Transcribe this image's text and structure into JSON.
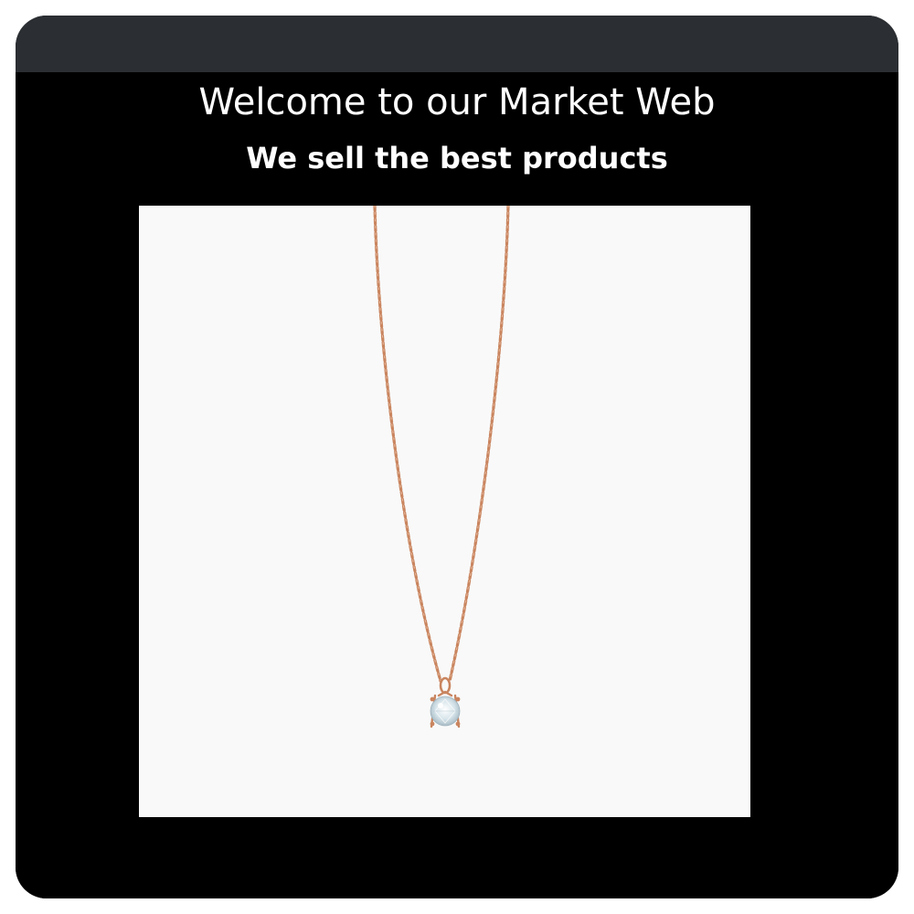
{
  "header": {
    "title": "Welcome to our Market Web",
    "subtitle": "We sell the best products"
  },
  "product": {
    "image_subject": "rose gold chain necklace with solitaire diamond pendant"
  },
  "colors": {
    "titlebar": "#2b2f33",
    "page_background": "#000000",
    "image_background": "#f9f9f9",
    "chain": "#c9855f",
    "diamond": "#dfe9ee"
  }
}
